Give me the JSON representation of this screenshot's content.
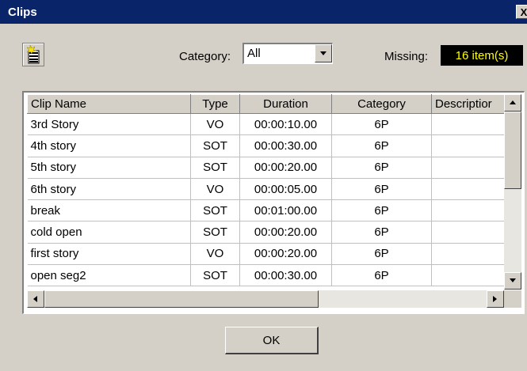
{
  "window": {
    "title": "Clips",
    "close_label": "X"
  },
  "toolbar": {
    "new_clip_icon": "new-clip-icon"
  },
  "filter": {
    "category_label": "Category:",
    "category_value": "All"
  },
  "missing": {
    "label": "Missing:",
    "value": "16 item(s)"
  },
  "table": {
    "columns": [
      "Clip Name",
      "Type",
      "Duration",
      "Category",
      "Descriptior"
    ],
    "rows": [
      [
        "3rd Story",
        "VO",
        "00:00:10.00",
        "6P",
        ""
      ],
      [
        "4th story",
        "SOT",
        "00:00:30.00",
        "6P",
        ""
      ],
      [
        "5th story",
        "SOT",
        "00:00:20.00",
        "6P",
        ""
      ],
      [
        "6th story",
        "VO",
        "00:00:05.00",
        "6P",
        ""
      ],
      [
        "break",
        "SOT",
        "00:01:00.00",
        "6P",
        ""
      ],
      [
        "cold open",
        "SOT",
        "00:00:20.00",
        "6P",
        ""
      ],
      [
        "first story",
        "VO",
        "00:00:20.00",
        "6P",
        ""
      ],
      [
        "open seg2",
        "SOT",
        "00:00:30.00",
        "6P",
        ""
      ]
    ]
  },
  "buttons": {
    "ok_label": "OK"
  },
  "colors": {
    "titlebar": "#0a246a",
    "missing_bg": "#000000",
    "missing_text": "#ffff00",
    "dialog_bg": "#d4d0c8"
  }
}
